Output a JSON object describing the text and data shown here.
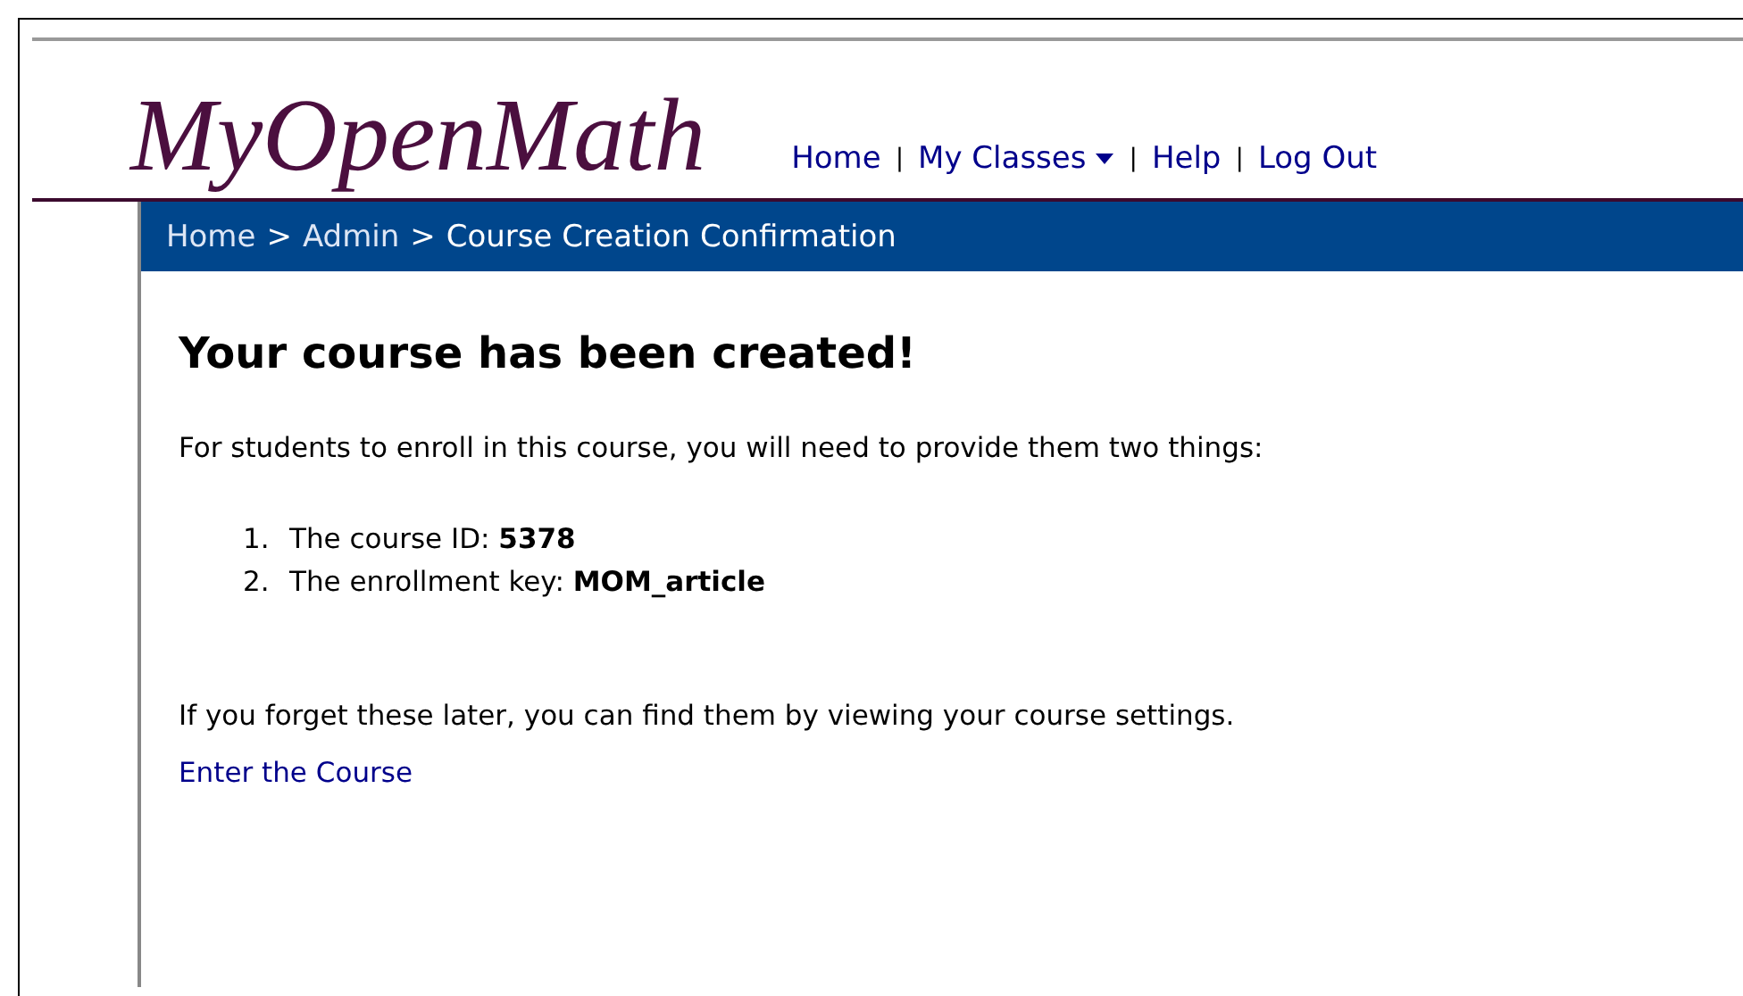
{
  "logo": "MyOpenMath",
  "nav": [
    {
      "label": "Home",
      "kind": "link"
    },
    {
      "label": "|",
      "kind": "separator"
    },
    {
      "label": "My Classes",
      "kind": "dropdown"
    },
    {
      "label": "|",
      "kind": "separator"
    },
    {
      "label": "Help",
      "kind": "link"
    },
    {
      "label": "|",
      "kind": "separator"
    },
    {
      "label": "Log Out",
      "kind": "link"
    }
  ],
  "breadcrumb": [
    {
      "label": "Home",
      "kind": "link"
    },
    {
      "label": ">",
      "kind": "separator"
    },
    {
      "label": "Admin",
      "kind": "link"
    },
    {
      "label": ">",
      "kind": "separator"
    },
    {
      "label": "Course Creation Confirmation",
      "kind": "current"
    }
  ],
  "heading": "Your course has been created!",
  "intro": "For students to enroll in this course, you will need to provide them two things:",
  "steps": [
    {
      "number": "1.",
      "text": "The course ID: **5378**"
    },
    {
      "number": "2.",
      "text": "The enrollment key: **MOM_article**"
    }
  ],
  "note": "If you forget these later, you can find them by viewing your course settings.",
  "enter_link": "Enter the Course"
}
